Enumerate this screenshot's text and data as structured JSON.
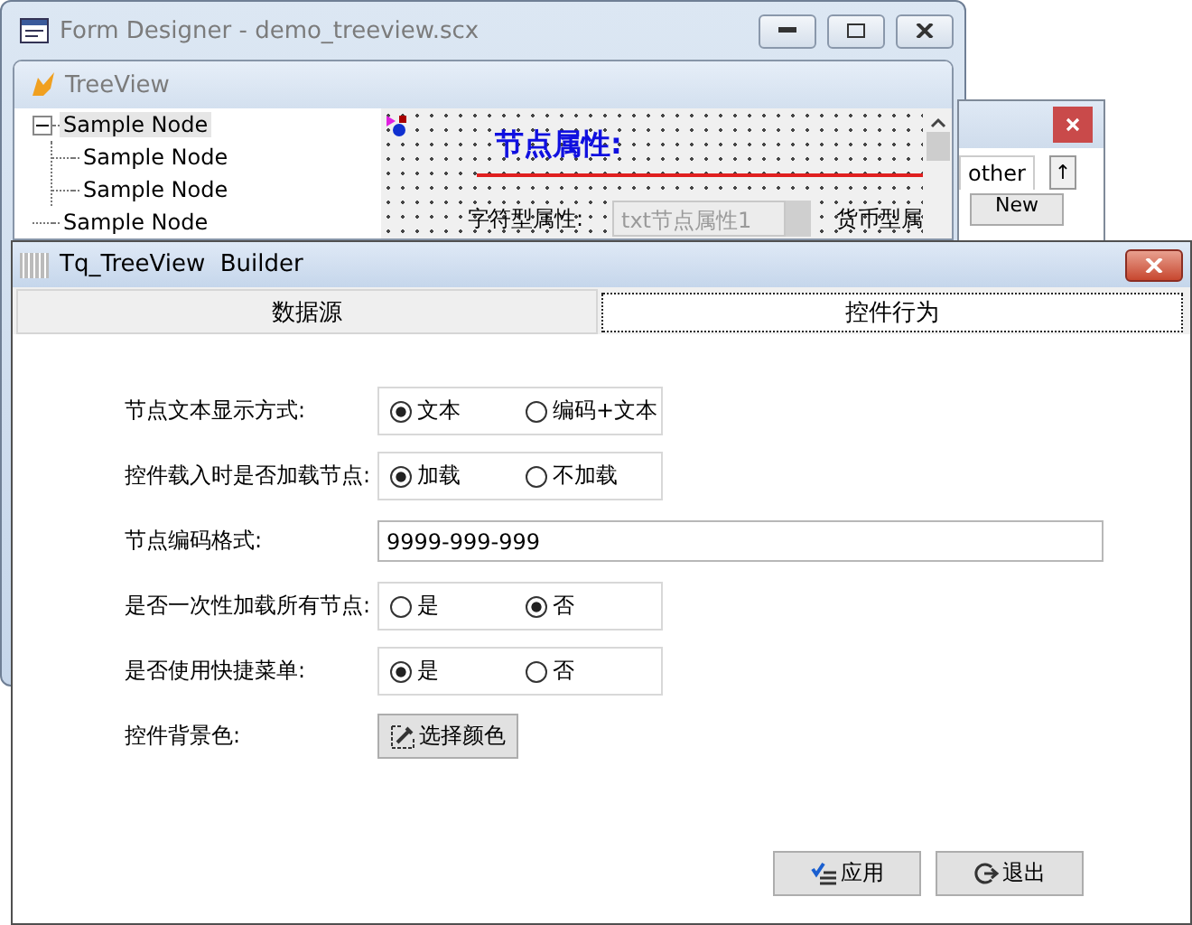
{
  "designer": {
    "title": "Form Designer - demo_treeview.scx",
    "form_title": "TreeView",
    "tree": [
      {
        "label": "Sample Node",
        "expanded": true,
        "selected": true,
        "children": [
          {
            "label": "Sample Node",
            "selected": false
          },
          {
            "label": "Sample Node",
            "selected": false
          }
        ]
      },
      {
        "label": "Sample Node",
        "selected": false
      }
    ],
    "canvas": {
      "heading": "节点属性:",
      "field_label": "字符型属性:",
      "field_value": "txt节点属性1",
      "label_2": "货币型属"
    }
  },
  "other_window": {
    "tab": "other",
    "arrow": "↑",
    "button": "New"
  },
  "builder": {
    "title": "Tq_TreeView  Builder",
    "tabs": [
      {
        "label": "数据源",
        "selected": false
      },
      {
        "label": "控件行为",
        "selected": true
      }
    ],
    "rows": [
      {
        "kind": "radio",
        "label": "节点文本显示方式:",
        "options": [
          {
            "label": "文本",
            "selected": true
          },
          {
            "label": "编码+文本",
            "selected": false
          }
        ]
      },
      {
        "kind": "radio",
        "label": "控件载入时是否加载节点:",
        "options": [
          {
            "label": "加载",
            "selected": true
          },
          {
            "label": "不加载",
            "selected": false
          }
        ]
      },
      {
        "kind": "text",
        "label": "节点编码格式:",
        "value": "9999-999-999"
      },
      {
        "kind": "radio",
        "label": "是否一次性加载所有节点:",
        "options": [
          {
            "label": "是",
            "selected": false
          },
          {
            "label": "否",
            "selected": true
          }
        ]
      },
      {
        "kind": "radio",
        "label": "是否使用快捷菜单:",
        "options": [
          {
            "label": "是",
            "selected": true
          },
          {
            "label": "否",
            "selected": false
          }
        ]
      },
      {
        "kind": "button",
        "label": "控件背景色:",
        "button": "选择颜色"
      }
    ],
    "buttons": [
      {
        "kind": "apply",
        "label": "应用"
      },
      {
        "kind": "exit",
        "label": "退出"
      }
    ]
  }
}
